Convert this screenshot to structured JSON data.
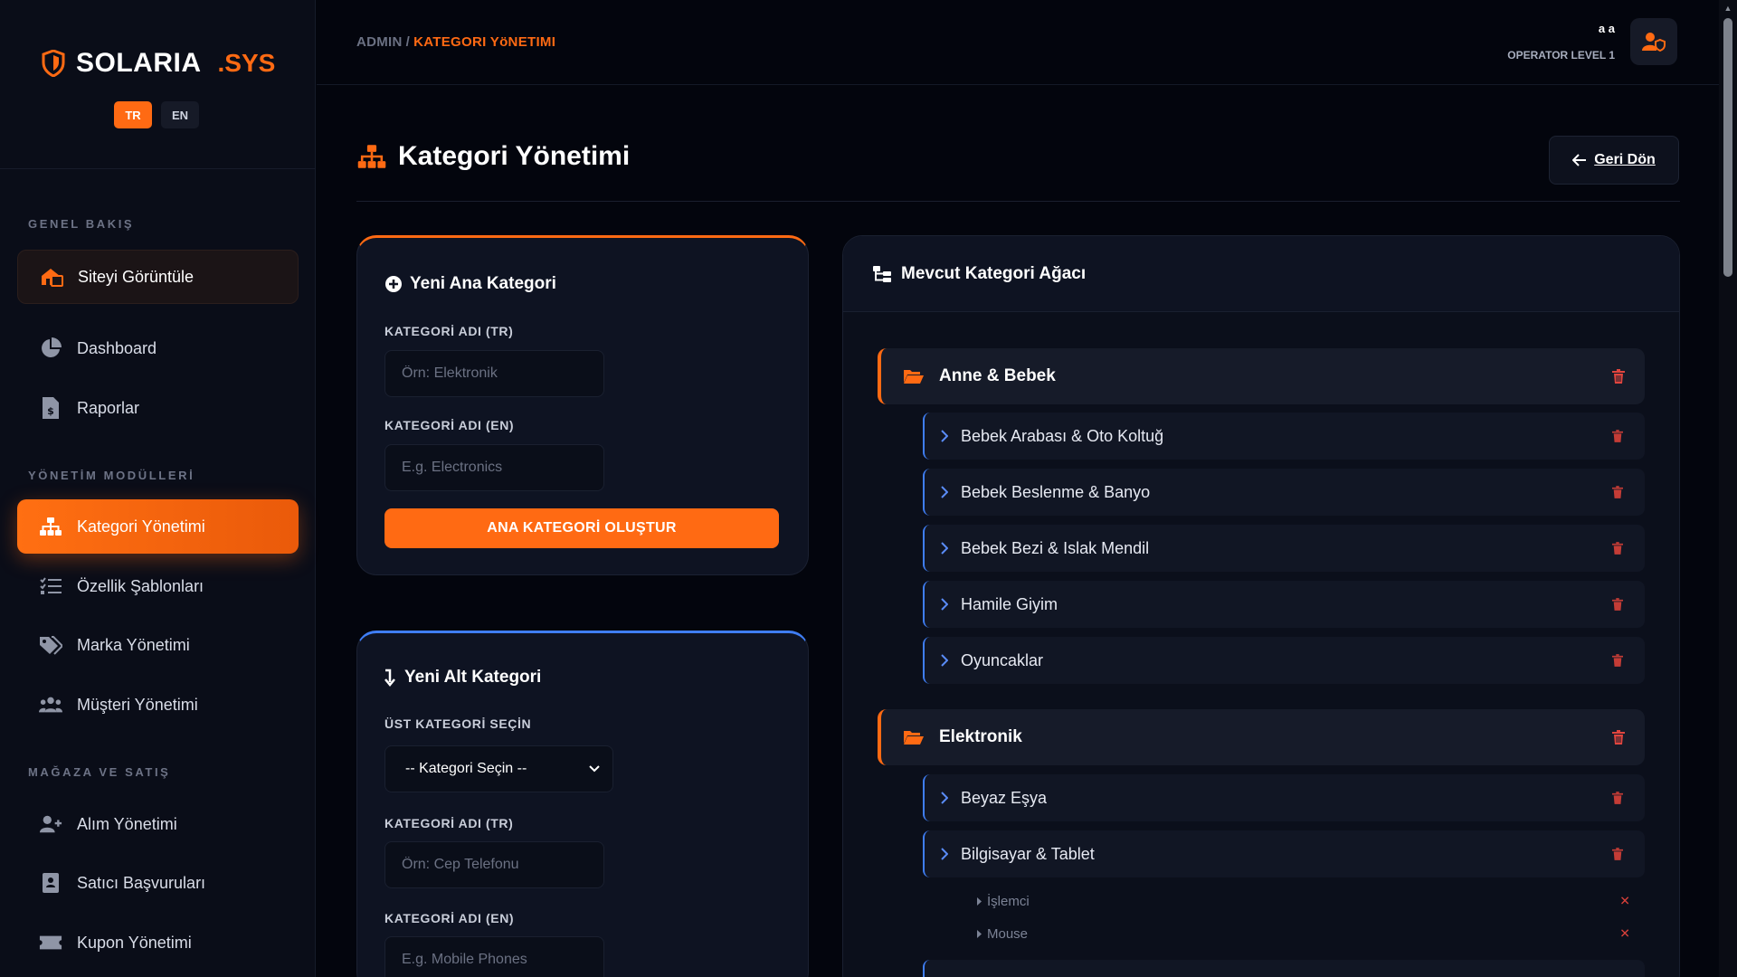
{
  "brand": {
    "name": "SOLARIA",
    "suffix": ".SYS"
  },
  "lang": {
    "tr": "TR",
    "en": "EN"
  },
  "sidebar": {
    "sections": {
      "overview": "GENEL BAKIŞ",
      "management": "YÖNETİM MODÜLLERİ",
      "store": "MAĞAZA VE SATIŞ"
    },
    "items": {
      "view_site": "Siteyi Görüntüle",
      "dashboard": "Dashboard",
      "reports": "Raporlar",
      "categories": "Kategori Yönetimi",
      "attribute_templates": "Özellik Şablonları",
      "brands": "Marka Yönetimi",
      "customers": "Müşteri Yönetimi",
      "purchases": "Alım Yönetimi",
      "seller_applications": "Satıcı Başvuruları",
      "coupons": "Kupon Yönetimi"
    }
  },
  "topbar": {
    "breadcrumb_root": "ADMIN",
    "breadcrumb_sep": "/",
    "breadcrumb_current": "KATEGORI YöNETIMI",
    "user_name": "a a",
    "user_level": "OPERATOR LEVEL 1"
  },
  "page": {
    "title": "Kategori Yönetimi",
    "back_label": "Geri Dön"
  },
  "new_main": {
    "title": "Yeni Ana Kategori",
    "label_tr": "KATEGORİ ADI (TR)",
    "placeholder_tr": "Örn: Elektronik",
    "label_en": "KATEGORİ ADI (EN)",
    "placeholder_en": "E.g. Electronics",
    "submit": "ANA KATEGORİ OLUŞTUR"
  },
  "new_sub": {
    "title": "Yeni Alt Kategori",
    "parent_label": "ÜST KATEGORİ SEÇİN",
    "parent_selected": "-- Kategori Seçin --",
    "label_tr": "KATEGORİ ADI (TR)",
    "placeholder_tr": "Örn: Cep Telefonu",
    "label_en": "KATEGORİ ADI (EN)",
    "placeholder_en": "E.g. Mobile Phones"
  },
  "tree": {
    "title": "Mevcut Kategori Ağacı",
    "roots": [
      {
        "name": "Anne & Bebek",
        "children": [
          "Bebek Arabası & Oto Koltuğ",
          "Bebek Beslenme & Banyo",
          "Bebek Bezi & Islak Mendil",
          "Hamile Giyim",
          "Oyuncaklar"
        ]
      },
      {
        "name": "Elektronik",
        "children": [
          "Beyaz Eşya",
          "Bilgisayar & Tablet"
        ],
        "grandchildren": [
          "İşlemci",
          "Mouse"
        ]
      }
    ]
  },
  "colors": {
    "accent": "#ff6a13",
    "blue": "#3f7ef5",
    "danger": "#d8403a"
  }
}
